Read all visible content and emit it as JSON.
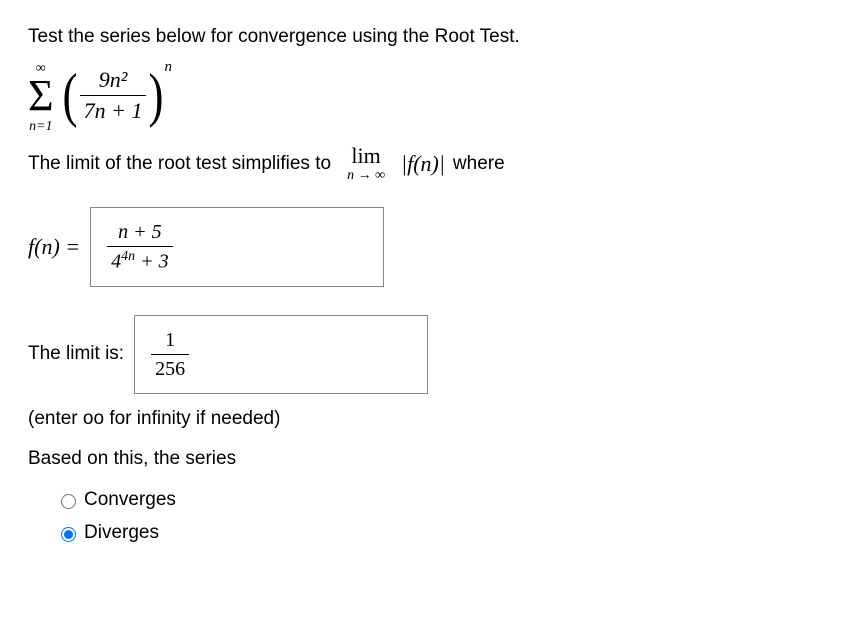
{
  "question": {
    "prompt": "Test the series below for convergence using the Root Test.",
    "series": {
      "sum_symbol": "Σ",
      "upper": "∞",
      "lower": "n=1",
      "numerator": "9n²",
      "denominator": "7n + 1",
      "exponent": "n"
    },
    "limit_line_pre": "The limit of the root test simplifies to",
    "lim_label": "lim",
    "lim_under": "n → ∞",
    "lim_func": "|f(n)|",
    "limit_line_post": "where",
    "fn_label": "f(n) =",
    "fn_answer": {
      "num": "n + 5",
      "den_base": "4",
      "den_exp": "4n",
      "den_suffix": " + 3"
    },
    "limit_label": "The limit is:",
    "limit_answer": {
      "num": "1",
      "den": "256"
    },
    "infinity_hint": "(enter oo for infinity if needed)",
    "based_on": "Based on this, the series",
    "options": {
      "converges": "Converges",
      "diverges": "Diverges"
    },
    "selected": "diverges"
  }
}
